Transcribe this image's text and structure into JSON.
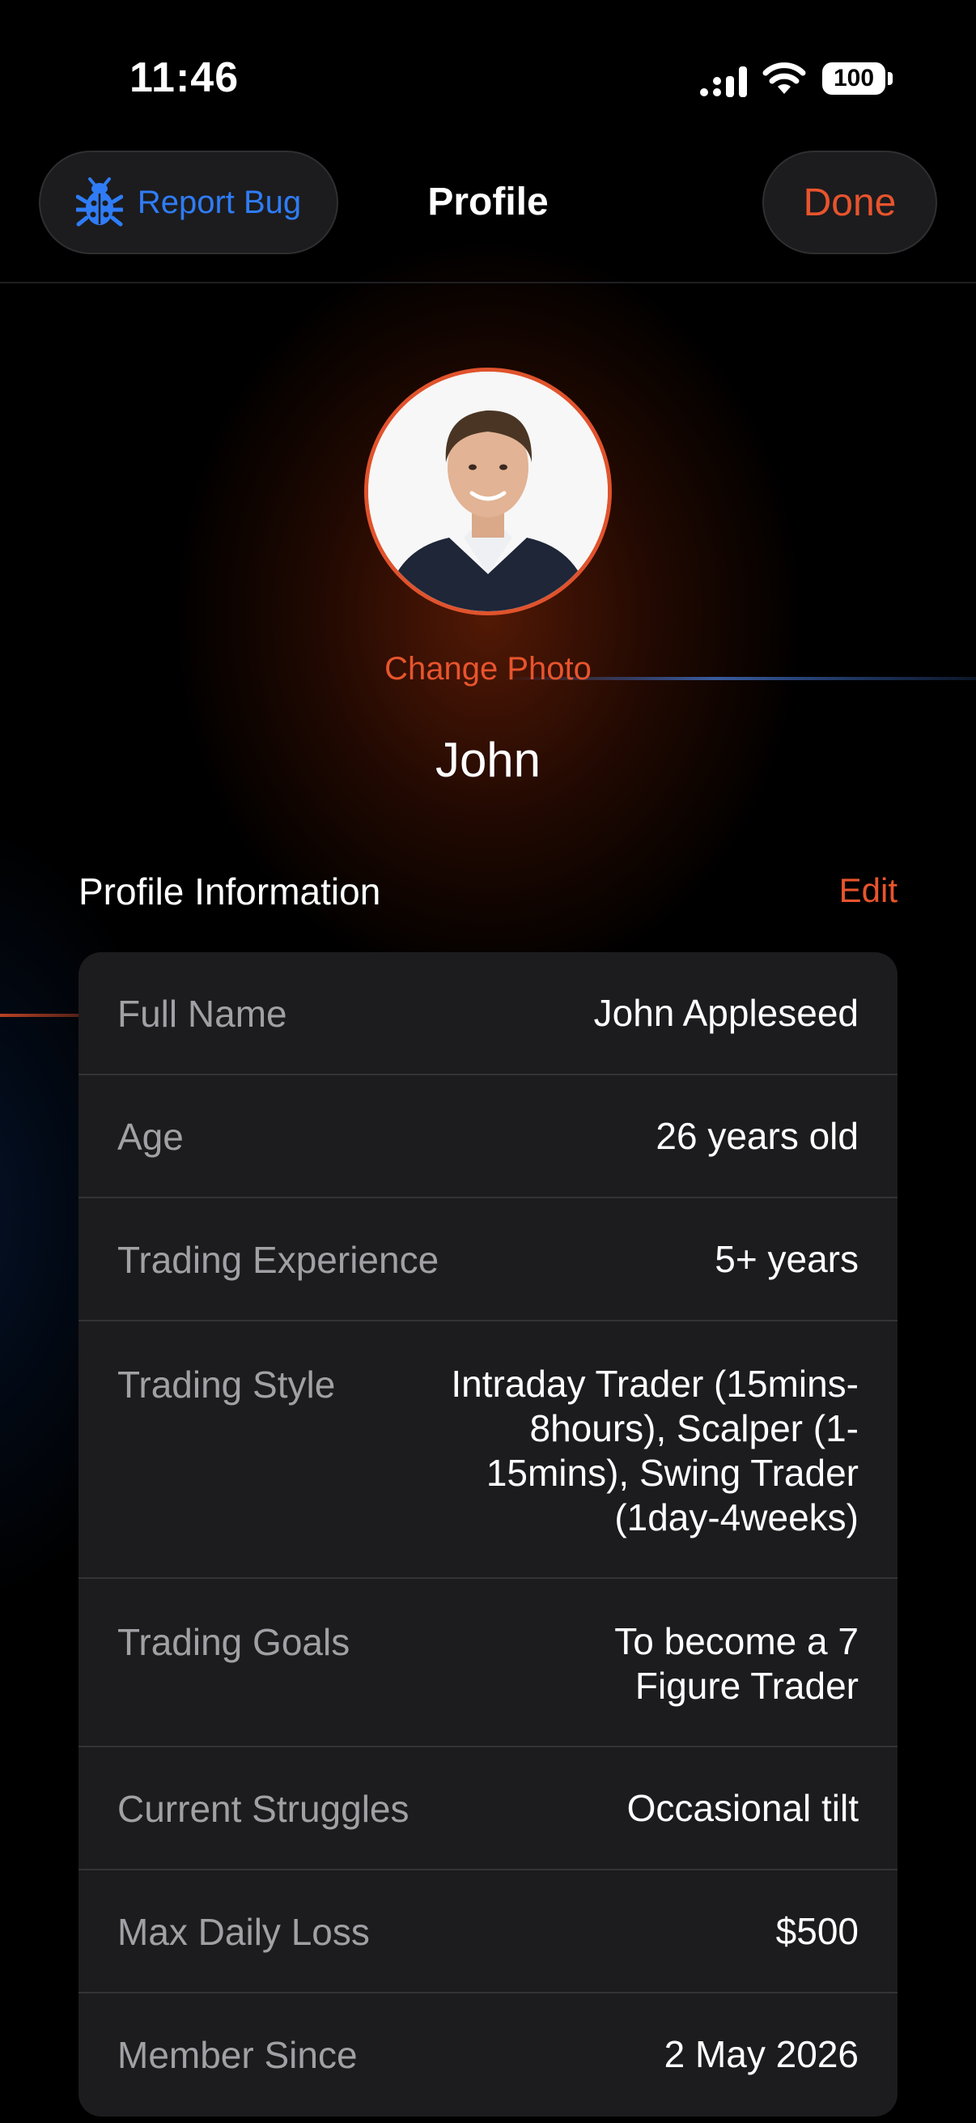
{
  "status_bar": {
    "time": "11:46",
    "battery": "100"
  },
  "nav": {
    "report_bug_label": "Report Bug",
    "title": "Profile",
    "done_label": "Done"
  },
  "profile": {
    "change_photo_label": "Change Photo",
    "display_name": "John"
  },
  "section": {
    "title": "Profile Information",
    "edit_label": "Edit"
  },
  "info_rows": [
    {
      "label": "Full Name",
      "value": "John Appleseed"
    },
    {
      "label": "Age",
      "value": "26 years old"
    },
    {
      "label": "Trading Experience",
      "value": "5+ years"
    },
    {
      "label": "Trading Style",
      "value": "Intraday Trader (15mins-8hours), Scalper (1-15mins), Swing Trader (1day-4weeks)"
    },
    {
      "label": "Trading Goals",
      "value": "To become a 7 Figure Trader"
    },
    {
      "label": "Current Struggles",
      "value": "Occasional tilt"
    },
    {
      "label": "Max Daily Loss",
      "value": "$500"
    },
    {
      "label": "Member Since",
      "value": "2 May 2026"
    }
  ],
  "colors": {
    "accent": "#e8542d",
    "link_blue": "#2f7cf6",
    "card_bg": "#1c1c1e",
    "background": "#000000"
  },
  "icons": {
    "report_bug": "bug-icon",
    "signal": "cellular-signal-icon",
    "wifi": "wifi-icon",
    "battery": "battery-icon"
  }
}
